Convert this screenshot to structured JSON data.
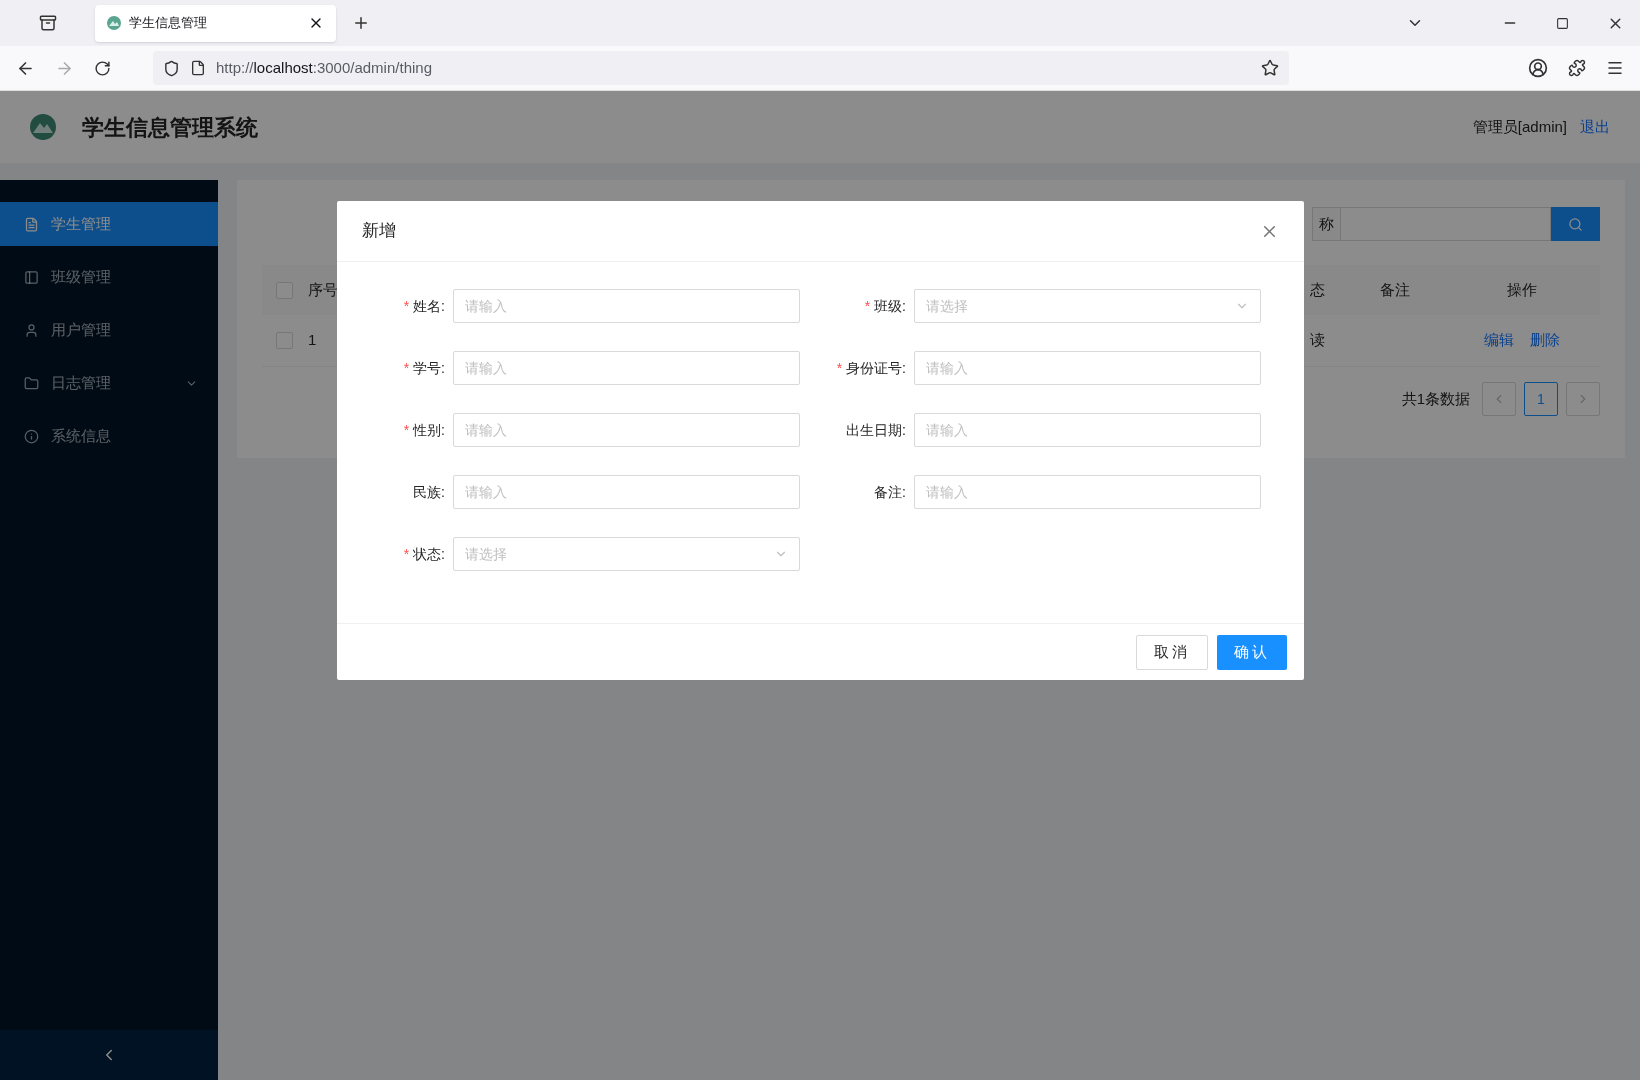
{
  "browser": {
    "tab_title": "学生信息管理",
    "url": "http://**localhost**:3000/admin/thing"
  },
  "header": {
    "title": "学生信息管理系统",
    "user": "管理员[admin]",
    "logout": "退出"
  },
  "sidebar": {
    "items": [
      {
        "label": "学生管理",
        "selected": true,
        "expandable": false
      },
      {
        "label": "班级管理",
        "selected": false,
        "expandable": false
      },
      {
        "label": "用户管理",
        "selected": false,
        "expandable": false
      },
      {
        "label": "日志管理",
        "selected": false,
        "expandable": true
      },
      {
        "label": "系统信息",
        "selected": false,
        "expandable": false
      }
    ]
  },
  "search": {
    "label": "称"
  },
  "table": {
    "header_checked": false,
    "columns": [
      "序号",
      "态",
      "备注",
      "操作"
    ],
    "rows": [
      {
        "checked": false,
        "cells": [
          "1",
          "读"
        ],
        "actions": [
          "编辑",
          "删除"
        ]
      }
    ]
  },
  "pagination": {
    "total": "共1条数据",
    "pages": [
      {
        "label": "1",
        "selected": true
      }
    ]
  },
  "modal": {
    "title": "新增",
    "fields": [
      {
        "required_mark": "*",
        "label": "姓名:",
        "kind": "input",
        "placeholder": "请输入"
      },
      {
        "required_mark": "*",
        "label": "班级:",
        "kind": "select",
        "placeholder": "请选择"
      },
      {
        "required_mark": "*",
        "label": "学号:",
        "kind": "input",
        "placeholder": "请输入"
      },
      {
        "required_mark": "*",
        "label": "身份证号:",
        "kind": "input",
        "placeholder": "请输入"
      },
      {
        "required_mark": "*",
        "label": "性别:",
        "kind": "input",
        "placeholder": "请输入"
      },
      {
        "label": "出生日期:",
        "kind": "input",
        "placeholder": "请输入"
      },
      {
        "label": "民族:",
        "kind": "input",
        "placeholder": "请输入"
      },
      {
        "label": "备注:",
        "kind": "input",
        "placeholder": "请输入"
      },
      {
        "required_mark": "*",
        "label": "状态:",
        "kind": "select",
        "placeholder": "请选择"
      }
    ],
    "buttons": [
      {
        "label": "取消",
        "kind": "default"
      },
      {
        "label": "确认",
        "kind": "primary"
      }
    ]
  }
}
